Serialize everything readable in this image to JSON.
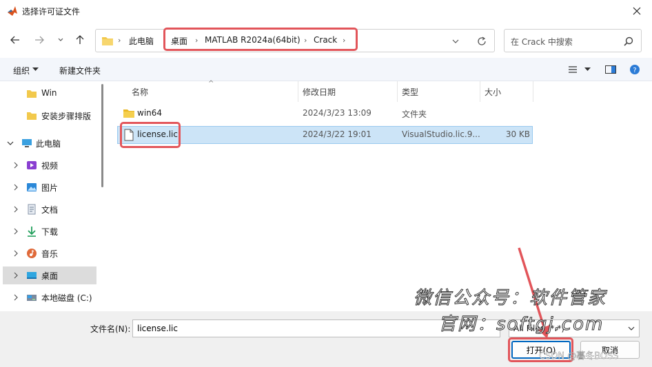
{
  "window": {
    "title": "选择许可证文件"
  },
  "address": {
    "crumbs": [
      "此电脑",
      "桌面",
      "MATLAB R2024a(64bit)",
      "Crack"
    ]
  },
  "search": {
    "placeholder": "在 Crack 中搜索"
  },
  "toolbar": {
    "organize": "组织",
    "new_folder": "新建文件夹"
  },
  "sidebar": {
    "items": [
      {
        "label": "Win",
        "icon": "folder-icon"
      },
      {
        "label": "安装步骤排版",
        "icon": "folder-icon"
      },
      {
        "label": "此电脑",
        "icon": "computer-icon"
      },
      {
        "label": "视频",
        "icon": "video-icon"
      },
      {
        "label": "图片",
        "icon": "picture-icon"
      },
      {
        "label": "文档",
        "icon": "document-icon"
      },
      {
        "label": "下载",
        "icon": "download-icon"
      },
      {
        "label": "音乐",
        "icon": "music-icon"
      },
      {
        "label": "桌面",
        "icon": "desktop-icon"
      },
      {
        "label": "本地磁盘 (C:)",
        "icon": "drive-icon"
      }
    ]
  },
  "columns": {
    "name": "名称",
    "modified": "修改日期",
    "type": "类型",
    "size": "大小"
  },
  "files": [
    {
      "name": "win64",
      "modified": "2024/3/23 13:09",
      "type": "文件夹",
      "size": ""
    },
    {
      "name": "license.lic",
      "modified": "2024/3/22 19:01",
      "type": "VisualStudio.lic.9...",
      "size": "30 KB"
    }
  ],
  "bottom": {
    "filename_label": "文件名(N):",
    "filename_value": "license.lic",
    "filetype": "All Files (*.*)",
    "open_label": "打开(O)",
    "cancel_label": "取消"
  },
  "overlay": {
    "watermark_line1": "微信公众号：软件管家",
    "watermark_line2": "官网：softgj.com",
    "csdn": "CSDN @暮冬BOSS"
  },
  "colors": {
    "highlight": "#e2555a",
    "selection": "#cce4f7",
    "accent": "#0067c0"
  }
}
